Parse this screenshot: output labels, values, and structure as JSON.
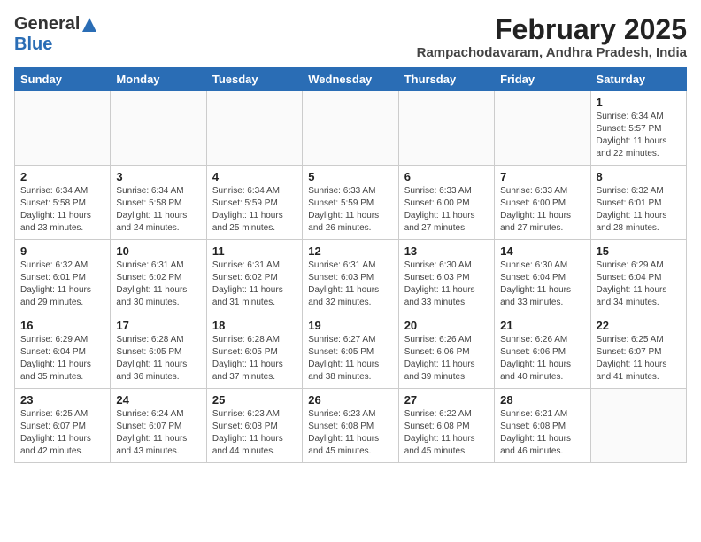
{
  "header": {
    "logo_general": "General",
    "logo_blue": "Blue",
    "month_year": "February 2025",
    "location": "Rampachodavaram, Andhra Pradesh, India"
  },
  "calendar": {
    "days_of_week": [
      "Sunday",
      "Monday",
      "Tuesday",
      "Wednesday",
      "Thursday",
      "Friday",
      "Saturday"
    ],
    "weeks": [
      [
        {
          "day": "",
          "info": ""
        },
        {
          "day": "",
          "info": ""
        },
        {
          "day": "",
          "info": ""
        },
        {
          "day": "",
          "info": ""
        },
        {
          "day": "",
          "info": ""
        },
        {
          "day": "",
          "info": ""
        },
        {
          "day": "1",
          "info": "Sunrise: 6:34 AM\nSunset: 5:57 PM\nDaylight: 11 hours\nand 22 minutes."
        }
      ],
      [
        {
          "day": "2",
          "info": "Sunrise: 6:34 AM\nSunset: 5:58 PM\nDaylight: 11 hours\nand 23 minutes."
        },
        {
          "day": "3",
          "info": "Sunrise: 6:34 AM\nSunset: 5:58 PM\nDaylight: 11 hours\nand 24 minutes."
        },
        {
          "day": "4",
          "info": "Sunrise: 6:34 AM\nSunset: 5:59 PM\nDaylight: 11 hours\nand 25 minutes."
        },
        {
          "day": "5",
          "info": "Sunrise: 6:33 AM\nSunset: 5:59 PM\nDaylight: 11 hours\nand 26 minutes."
        },
        {
          "day": "6",
          "info": "Sunrise: 6:33 AM\nSunset: 6:00 PM\nDaylight: 11 hours\nand 27 minutes."
        },
        {
          "day": "7",
          "info": "Sunrise: 6:33 AM\nSunset: 6:00 PM\nDaylight: 11 hours\nand 27 minutes."
        },
        {
          "day": "8",
          "info": "Sunrise: 6:32 AM\nSunset: 6:01 PM\nDaylight: 11 hours\nand 28 minutes."
        }
      ],
      [
        {
          "day": "9",
          "info": "Sunrise: 6:32 AM\nSunset: 6:01 PM\nDaylight: 11 hours\nand 29 minutes."
        },
        {
          "day": "10",
          "info": "Sunrise: 6:31 AM\nSunset: 6:02 PM\nDaylight: 11 hours\nand 30 minutes."
        },
        {
          "day": "11",
          "info": "Sunrise: 6:31 AM\nSunset: 6:02 PM\nDaylight: 11 hours\nand 31 minutes."
        },
        {
          "day": "12",
          "info": "Sunrise: 6:31 AM\nSunset: 6:03 PM\nDaylight: 11 hours\nand 32 minutes."
        },
        {
          "day": "13",
          "info": "Sunrise: 6:30 AM\nSunset: 6:03 PM\nDaylight: 11 hours\nand 33 minutes."
        },
        {
          "day": "14",
          "info": "Sunrise: 6:30 AM\nSunset: 6:04 PM\nDaylight: 11 hours\nand 33 minutes."
        },
        {
          "day": "15",
          "info": "Sunrise: 6:29 AM\nSunset: 6:04 PM\nDaylight: 11 hours\nand 34 minutes."
        }
      ],
      [
        {
          "day": "16",
          "info": "Sunrise: 6:29 AM\nSunset: 6:04 PM\nDaylight: 11 hours\nand 35 minutes."
        },
        {
          "day": "17",
          "info": "Sunrise: 6:28 AM\nSunset: 6:05 PM\nDaylight: 11 hours\nand 36 minutes."
        },
        {
          "day": "18",
          "info": "Sunrise: 6:28 AM\nSunset: 6:05 PM\nDaylight: 11 hours\nand 37 minutes."
        },
        {
          "day": "19",
          "info": "Sunrise: 6:27 AM\nSunset: 6:05 PM\nDaylight: 11 hours\nand 38 minutes."
        },
        {
          "day": "20",
          "info": "Sunrise: 6:26 AM\nSunset: 6:06 PM\nDaylight: 11 hours\nand 39 minutes."
        },
        {
          "day": "21",
          "info": "Sunrise: 6:26 AM\nSunset: 6:06 PM\nDaylight: 11 hours\nand 40 minutes."
        },
        {
          "day": "22",
          "info": "Sunrise: 6:25 AM\nSunset: 6:07 PM\nDaylight: 11 hours\nand 41 minutes."
        }
      ],
      [
        {
          "day": "23",
          "info": "Sunrise: 6:25 AM\nSunset: 6:07 PM\nDaylight: 11 hours\nand 42 minutes."
        },
        {
          "day": "24",
          "info": "Sunrise: 6:24 AM\nSunset: 6:07 PM\nDaylight: 11 hours\nand 43 minutes."
        },
        {
          "day": "25",
          "info": "Sunrise: 6:23 AM\nSunset: 6:08 PM\nDaylight: 11 hours\nand 44 minutes."
        },
        {
          "day": "26",
          "info": "Sunrise: 6:23 AM\nSunset: 6:08 PM\nDaylight: 11 hours\nand 45 minutes."
        },
        {
          "day": "27",
          "info": "Sunrise: 6:22 AM\nSunset: 6:08 PM\nDaylight: 11 hours\nand 45 minutes."
        },
        {
          "day": "28",
          "info": "Sunrise: 6:21 AM\nSunset: 6:08 PM\nDaylight: 11 hours\nand 46 minutes."
        },
        {
          "day": "",
          "info": ""
        }
      ]
    ]
  }
}
